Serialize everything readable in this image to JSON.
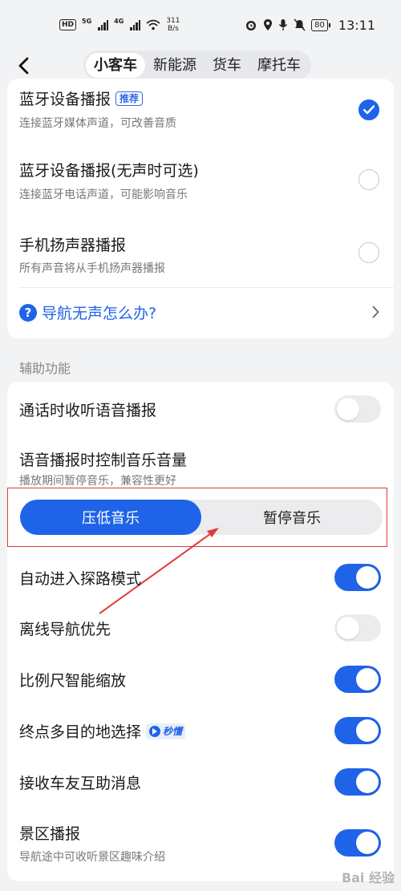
{
  "status_bar": {
    "hd": "HD",
    "sig1_label": "5G",
    "sig2_label": "4G",
    "speed_value": "311",
    "speed_unit": "B/s",
    "battery": "80",
    "time": "13:11"
  },
  "nav": {
    "tabs": [
      {
        "label": "小客车",
        "active": true
      },
      {
        "label": "新能源",
        "active": false
      },
      {
        "label": "货车",
        "active": false
      },
      {
        "label": "摩托车",
        "active": false
      }
    ]
  },
  "broadcast_options": [
    {
      "title": "蓝牙设备播报",
      "badge": "推荐",
      "subtitle": "连接蓝牙媒体声道，可改善音质",
      "checked": true
    },
    {
      "title": "蓝牙设备播报(无声时可选)",
      "subtitle": "连接蓝牙电话声道，可能影响音乐",
      "checked": false
    },
    {
      "title": "手机扬声器播报",
      "subtitle": "所有声音将从手机扬声器播报",
      "checked": false
    }
  ],
  "help_link": {
    "icon": "?",
    "label": "导航无声怎么办?"
  },
  "section_label": "辅助功能",
  "call_listen": {
    "label": "通话时收听语音播报",
    "on": false
  },
  "music_control": {
    "title": "语音播报时控制音乐音量",
    "subtitle": "播放期间暂停音乐，兼容性更好",
    "options": [
      "压低音乐",
      "暂停音乐"
    ],
    "selected": 0
  },
  "toggles": [
    {
      "label": "自动进入探路模式",
      "on": true
    },
    {
      "label": "离线导航优先",
      "on": false
    },
    {
      "label": "比例尺智能缩放",
      "on": true
    },
    {
      "label": "终点多目的地选择",
      "badge": "秒懂",
      "on": true
    },
    {
      "label": "接收车友互助消息",
      "on": true
    }
  ],
  "scenic": {
    "label": "景区播报",
    "subtitle": "导航途中可收听景区趣味介绍",
    "on": true
  },
  "colors": {
    "accent": "#1f64e8",
    "annotation": "#e03a3a"
  },
  "watermark": "Bai 经验"
}
